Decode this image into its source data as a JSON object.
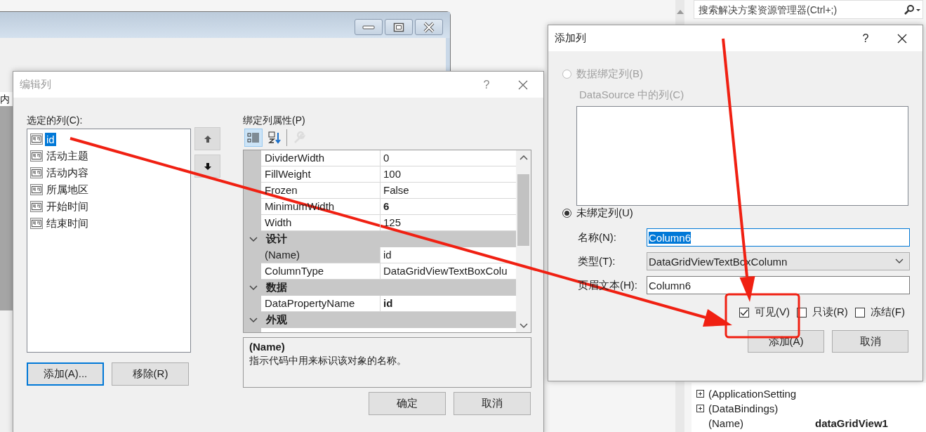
{
  "solution_explorer": {
    "search_placeholder": "搜索解决方案资源管理器(Ctrl+;)"
  },
  "designer": {
    "grid_header_text": "内"
  },
  "edit_dialog": {
    "title": "编辑列",
    "help": "?",
    "selected_columns_label": "选定的列(C):",
    "columns": [
      {
        "label": "id",
        "selected": true
      },
      {
        "label": "活动主题",
        "selected": false
      },
      {
        "label": "活动内容",
        "selected": false
      },
      {
        "label": "所属地区",
        "selected": false
      },
      {
        "label": "开始时间",
        "selected": false
      },
      {
        "label": "结束时间",
        "selected": false
      }
    ],
    "properties_label": "绑定列属性(P)",
    "toolbar": [
      {
        "kind": "categorized",
        "selected": true,
        "disabled": false
      },
      {
        "kind": "alphabetical",
        "selected": false,
        "disabled": false
      },
      {
        "kind": "property_pages",
        "selected": false,
        "disabled": true
      }
    ],
    "grid_rows": [
      {
        "kind": "property",
        "name": "DividerWidth",
        "value": "0",
        "bold": false,
        "selected": false
      },
      {
        "kind": "property",
        "name": "FillWeight",
        "value": "100",
        "bold": false,
        "selected": false
      },
      {
        "kind": "property",
        "name": "Frozen",
        "value": "False",
        "bold": false,
        "selected": false
      },
      {
        "kind": "property",
        "name": "MinimumWidth",
        "value": "6",
        "bold": true,
        "selected": false
      },
      {
        "kind": "property",
        "name": "Width",
        "value": "125",
        "bold": false,
        "selected": false
      },
      {
        "kind": "category",
        "name": "设计",
        "expanded": true
      },
      {
        "kind": "property",
        "name": "(Name)",
        "value": "id",
        "bold": false,
        "selected": true
      },
      {
        "kind": "property",
        "name": "ColumnType",
        "value": "DataGridViewTextBoxColu",
        "bold": false,
        "selected": false
      },
      {
        "kind": "category",
        "name": "数据",
        "expanded": true
      },
      {
        "kind": "property",
        "name": "DataPropertyName",
        "value": "id",
        "bold": true,
        "selected": false
      },
      {
        "kind": "category",
        "name": "外观",
        "expanded": true
      }
    ],
    "description": {
      "title": "(Name)",
      "text": "指示代码中用来标识该对象的名称。"
    },
    "add_button": "添加(A)...",
    "remove_button": "移除(R)",
    "ok_button": "确定",
    "cancel_button": "取消"
  },
  "add_dialog": {
    "title": "添加列",
    "help": "?",
    "bound_option": {
      "label": "数据绑定列(B)",
      "selected": false,
      "disabled": true
    },
    "datasource_label": "DataSource 中的列(C)",
    "unbound_option": {
      "label": "未绑定列(U)",
      "selected": true,
      "disabled": false
    },
    "name_label": "名称(N):",
    "name_value": "Column6",
    "type_label": "类型(T):",
    "type_value": "DataGridViewTextBoxColumn",
    "header_label": "页眉文本(H):",
    "header_value": "Column6",
    "checkboxes": [
      {
        "label": "可见(V)",
        "checked": true
      },
      {
        "label": "只读(R)",
        "checked": false
      },
      {
        "label": "冻结(F)",
        "checked": false
      }
    ],
    "add_button": "添加(A)",
    "cancel_button": "取消"
  },
  "properties_panel": {
    "rows": [
      {
        "name": "(ApplicationSetting",
        "expandable": true
      },
      {
        "name": "(DataBindings)",
        "expandable": true
      },
      {
        "name": "(Name)",
        "value": "dataGridView1",
        "expandable": false
      }
    ]
  }
}
